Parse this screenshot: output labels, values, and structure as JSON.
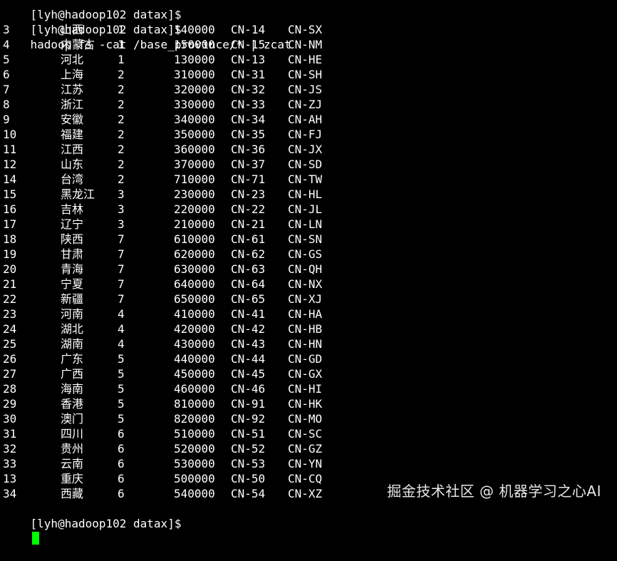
{
  "terminal": {
    "prev_prompt": "[lyh@hadoop102 datax]$",
    "command_prompt": "[lyh@hadoop102 datax]$",
    "command": "hadoop fs -cat /base_province/* | zcat",
    "final_prompt": "[lyh@hadoop102 datax]$",
    "cursor_color": "#00ff00",
    "rows": [
      [
        "3",
        "山西",
        "1",
        "140000",
        "CN-14",
        "CN-SX"
      ],
      [
        "4",
        "内蒙古",
        "1",
        "150000",
        "CN-15",
        "CN-NM"
      ],
      [
        "5",
        "河北",
        "1",
        "130000",
        "CN-13",
        "CN-HE"
      ],
      [
        "6",
        "上海",
        "2",
        "310000",
        "CN-31",
        "CN-SH"
      ],
      [
        "7",
        "江苏",
        "2",
        "320000",
        "CN-32",
        "CN-JS"
      ],
      [
        "8",
        "浙江",
        "2",
        "330000",
        "CN-33",
        "CN-ZJ"
      ],
      [
        "9",
        "安徽",
        "2",
        "340000",
        "CN-34",
        "CN-AH"
      ],
      [
        "10",
        "福建",
        "2",
        "350000",
        "CN-35",
        "CN-FJ"
      ],
      [
        "11",
        "江西",
        "2",
        "360000",
        "CN-36",
        "CN-JX"
      ],
      [
        "12",
        "山东",
        "2",
        "370000",
        "CN-37",
        "CN-SD"
      ],
      [
        "14",
        "台湾",
        "2",
        "710000",
        "CN-71",
        "CN-TW"
      ],
      [
        "15",
        "黑龙江",
        "3",
        "230000",
        "CN-23",
        "CN-HL"
      ],
      [
        "16",
        "吉林",
        "3",
        "220000",
        "CN-22",
        "CN-JL"
      ],
      [
        "17",
        "辽宁",
        "3",
        "210000",
        "CN-21",
        "CN-LN"
      ],
      [
        "18",
        "陕西",
        "7",
        "610000",
        "CN-61",
        "CN-SN"
      ],
      [
        "19",
        "甘肃",
        "7",
        "620000",
        "CN-62",
        "CN-GS"
      ],
      [
        "20",
        "青海",
        "7",
        "630000",
        "CN-63",
        "CN-QH"
      ],
      [
        "21",
        "宁夏",
        "7",
        "640000",
        "CN-64",
        "CN-NX"
      ],
      [
        "22",
        "新疆",
        "7",
        "650000",
        "CN-65",
        "CN-XJ"
      ],
      [
        "23",
        "河南",
        "4",
        "410000",
        "CN-41",
        "CN-HA"
      ],
      [
        "24",
        "湖北",
        "4",
        "420000",
        "CN-42",
        "CN-HB"
      ],
      [
        "25",
        "湖南",
        "4",
        "430000",
        "CN-43",
        "CN-HN"
      ],
      [
        "26",
        "广东",
        "5",
        "440000",
        "CN-44",
        "CN-GD"
      ],
      [
        "27",
        "广西",
        "5",
        "450000",
        "CN-45",
        "CN-GX"
      ],
      [
        "28",
        "海南",
        "5",
        "460000",
        "CN-46",
        "CN-HI"
      ],
      [
        "29",
        "香港",
        "5",
        "810000",
        "CN-91",
        "CN-HK"
      ],
      [
        "30",
        "澳门",
        "5",
        "820000",
        "CN-92",
        "CN-MO"
      ],
      [
        "31",
        "四川",
        "6",
        "510000",
        "CN-51",
        "CN-SC"
      ],
      [
        "32",
        "贵州",
        "6",
        "520000",
        "CN-52",
        "CN-GZ"
      ],
      [
        "33",
        "云南",
        "6",
        "530000",
        "CN-53",
        "CN-YN"
      ],
      [
        "13",
        "重庆",
        "6",
        "500000",
        "CN-50",
        "CN-CQ"
      ],
      [
        "34",
        "西藏",
        "6",
        "540000",
        "CN-54",
        "CN-XZ"
      ]
    ]
  },
  "watermark": {
    "text": "掘金技术社区 @ 机器学习之心AI"
  }
}
